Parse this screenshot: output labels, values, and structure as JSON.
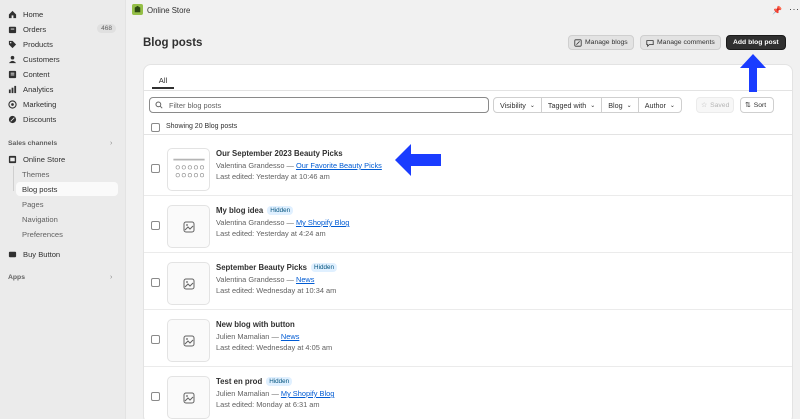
{
  "sidebar": {
    "items": [
      {
        "label": "Home",
        "icon": "home-icon"
      },
      {
        "label": "Orders",
        "icon": "orders-icon",
        "badge": "468"
      },
      {
        "label": "Products",
        "icon": "tag-icon"
      },
      {
        "label": "Customers",
        "icon": "person-icon"
      },
      {
        "label": "Content",
        "icon": "content-icon"
      },
      {
        "label": "Analytics",
        "icon": "chart-icon"
      },
      {
        "label": "Marketing",
        "icon": "target-icon"
      },
      {
        "label": "Discounts",
        "icon": "discount-icon"
      }
    ],
    "sales_channels_label": "Sales channels",
    "online_store_label": "Online Store",
    "online_store_sub": [
      "Themes",
      "Blog posts",
      "Pages",
      "Navigation",
      "Preferences"
    ],
    "buy_button_label": "Buy Button",
    "apps_label": "Apps"
  },
  "topbar": {
    "store_name": "Online Store"
  },
  "page": {
    "title": "Blog posts",
    "manage_blogs": "Manage blogs",
    "manage_comments": "Manage comments",
    "add_blog_post": "Add blog post"
  },
  "toolbar": {
    "tab_all": "All",
    "search_placeholder": "Filter blog posts",
    "filters": [
      "Visibility",
      "Tagged with",
      "Blog",
      "Author"
    ],
    "saved": "Saved",
    "sort": "Sort",
    "showing": "Showing 20 Blog posts"
  },
  "posts": [
    {
      "title": "Our September 2023 Beauty Picks",
      "author": "Valentina Grandesso",
      "blog": "Our Favorite Beauty Picks",
      "edited": "Last edited: Yesterday at 10:46 am",
      "hidden": ""
    },
    {
      "title": "My blog idea",
      "author": "Valentina Grandesso",
      "blog": "My Shopify Blog",
      "edited": "Last edited: Yesterday at 4:24 am",
      "hidden": "Hidden"
    },
    {
      "title": "September Beauty Picks",
      "author": "Valentina Grandesso",
      "blog": "News",
      "edited": "Last edited: Wednesday at 10:34 am",
      "hidden": "Hidden"
    },
    {
      "title": "New blog with button",
      "author": "Julien Mamalian",
      "blog": "News",
      "edited": "Last edited: Wednesday at 4:05 am",
      "hidden": ""
    },
    {
      "title": "Test en prod",
      "author": "Julien Mamalian",
      "blog": "My Shopify Blog",
      "edited": "Last edited: Monday at 6:31 am",
      "hidden": "Hidden"
    }
  ],
  "separator": " — ",
  "colors": {
    "accent": "#1a3cff",
    "primary_button": "#303030",
    "link": "#005bd3",
    "hidden_badge": "#e0f0ff"
  }
}
